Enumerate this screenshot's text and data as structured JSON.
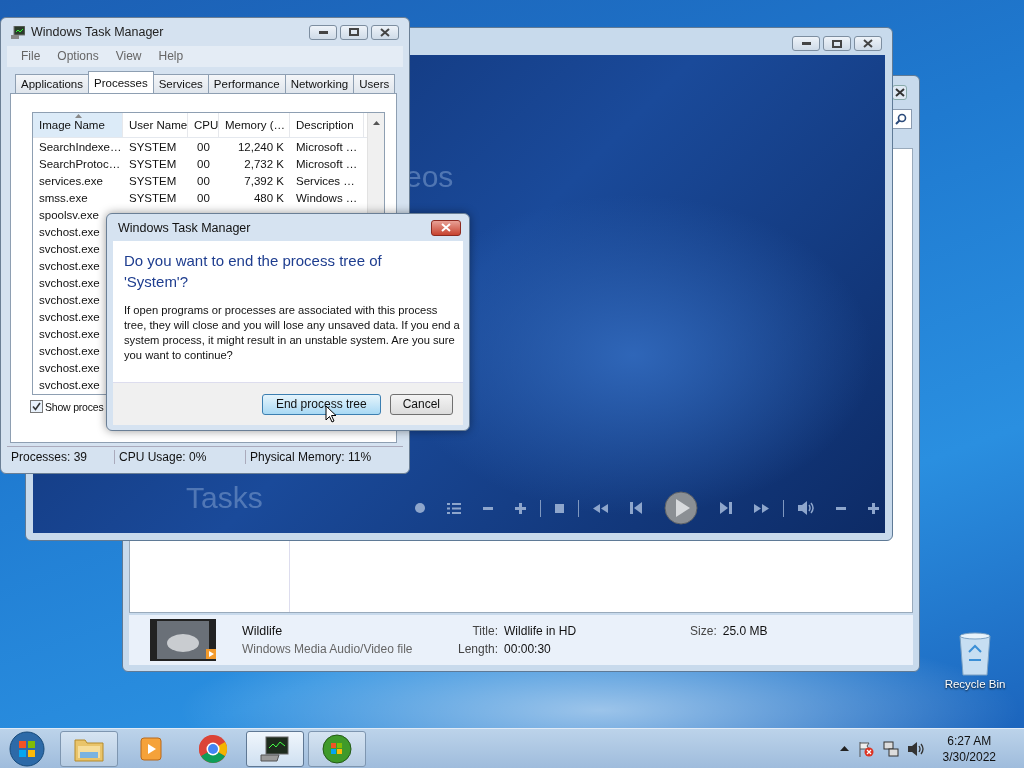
{
  "desktop": {
    "icons": [
      {
        "label": "Recycle Bin"
      }
    ]
  },
  "explorer_window": {
    "details": {
      "name": "Wildlife",
      "type": "Windows Media Audio/Video file",
      "fields": [
        {
          "label": "Title:",
          "value": "Wildlife in HD"
        },
        {
          "label": "Length:",
          "value": "00:00:30"
        },
        {
          "label": "Size:",
          "value": "25.0 MB"
        }
      ]
    }
  },
  "media_player": {
    "background_texts": [
      "eos",
      "Tasks"
    ]
  },
  "task_manager": {
    "title": "Windows Task Manager",
    "menu": [
      "File",
      "Options",
      "View",
      "Help"
    ],
    "tabs": [
      {
        "label": "Applications",
        "selected": false
      },
      {
        "label": "Processes",
        "selected": true
      },
      {
        "label": "Services",
        "selected": false
      },
      {
        "label": "Performance",
        "selected": false
      },
      {
        "label": "Networking",
        "selected": false
      },
      {
        "label": "Users",
        "selected": false
      }
    ],
    "columns": [
      {
        "label": "Image Name",
        "sorted": true
      },
      {
        "label": "User Name",
        "sorted": false
      },
      {
        "label": "CPU",
        "sorted": false
      },
      {
        "label": "Memory (…",
        "sorted": false
      },
      {
        "label": "Description",
        "sorted": false
      }
    ],
    "rows": [
      {
        "cells": [
          "SearchIndexe…",
          "SYSTEM",
          "00",
          "12,240 K",
          "Microsoft …"
        ]
      },
      {
        "cells": [
          "SearchProtoc…",
          "SYSTEM",
          "00",
          "2,732 K",
          "Microsoft …"
        ]
      },
      {
        "cells": [
          "services.exe",
          "SYSTEM",
          "00",
          "7,392 K",
          "Services …"
        ]
      },
      {
        "cells": [
          "smss.exe",
          "SYSTEM",
          "00",
          "480 K",
          "Windows …"
        ]
      },
      {
        "cells": [
          "spoolsv.exe"
        ]
      },
      {
        "cells": [
          "svchost.exe"
        ]
      },
      {
        "cells": [
          "svchost.exe"
        ]
      },
      {
        "cells": [
          "svchost.exe"
        ]
      },
      {
        "cells": [
          "svchost.exe"
        ]
      },
      {
        "cells": [
          "svchost.exe"
        ]
      },
      {
        "cells": [
          "svchost.exe"
        ]
      },
      {
        "cells": [
          "svchost.exe"
        ]
      },
      {
        "cells": [
          "svchost.exe"
        ]
      },
      {
        "cells": [
          "svchost.exe"
        ]
      },
      {
        "cells": [
          "svchost.exe"
        ]
      }
    ],
    "show_all": {
      "label": "Show proces",
      "checked": true
    },
    "status_bar": [
      "Processes: 39",
      "CPU Usage: 0%",
      "Physical Memory: 11%"
    ]
  },
  "dialog": {
    "title": "Windows Task Manager",
    "heading": "Do you want to end the process tree of 'System'?",
    "message": "If open programs or processes are associated with this process tree, they will close and you will lose any unsaved data. If you end a system process, it might result in an unstable system. Are you sure you want to continue?",
    "buttons": [
      {
        "label": "End process tree",
        "default": true
      },
      {
        "label": "Cancel",
        "default": false
      }
    ]
  },
  "taskbar": {
    "apps": [
      {
        "kind": "folder",
        "running": true,
        "selected": false
      },
      {
        "kind": "player",
        "running": false,
        "selected": false
      },
      {
        "kind": "browser",
        "running": false,
        "selected": false
      },
      {
        "kind": "monitor",
        "running": true,
        "selected": true
      },
      {
        "kind": "orb",
        "running": true,
        "selected": false
      }
    ],
    "clock": {
      "time": "6:27 AM",
      "date": "3/30/2022"
    }
  }
}
